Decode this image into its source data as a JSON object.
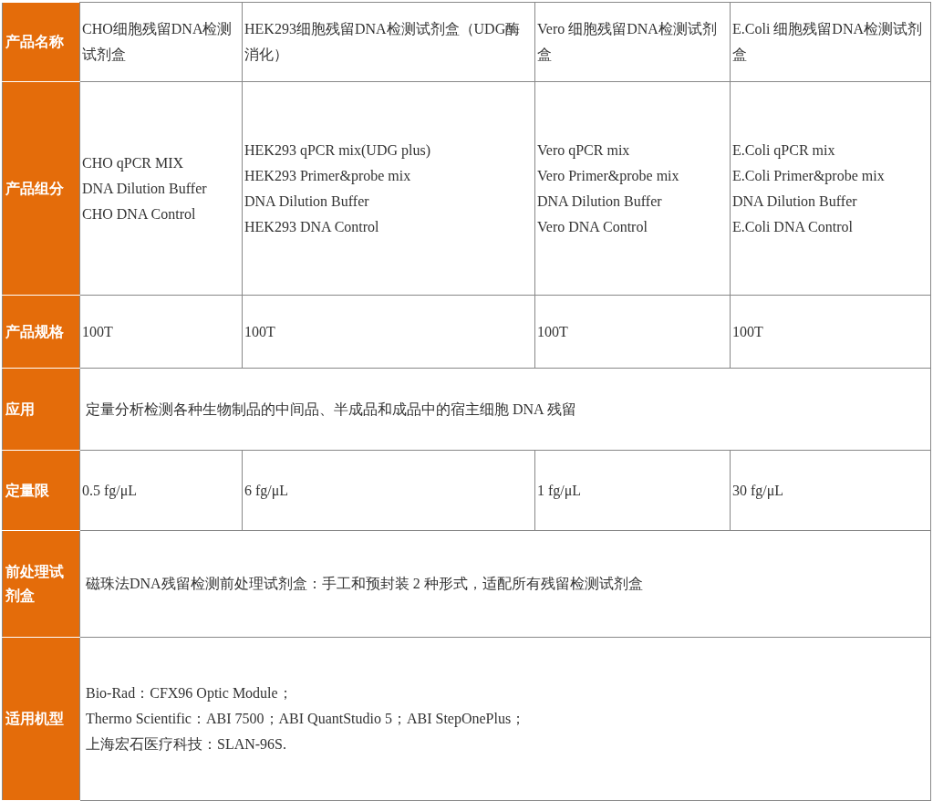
{
  "rows": [
    {
      "header": "产品名称",
      "kind": "cells",
      "cells": [
        {
          "lines": [
            "CHO细胞残留DNA检测试剂盒"
          ]
        },
        {
          "lines": [
            "HEK293细胞残留DNA检测试剂盒（UDG酶消化）"
          ]
        },
        {
          "lines": [
            "Vero 细胞残留DNA检测试剂盒"
          ]
        },
        {
          "lines": [
            "E.Coli 细胞残留DNA检测试剂盒"
          ]
        }
      ]
    },
    {
      "header": "产品组分",
      "kind": "cells",
      "cells": [
        {
          "lines": [
            "CHO qPCR MIX",
            "DNA Dilution Buffer",
            "CHO DNA Control"
          ]
        },
        {
          "lines": [
            "HEK293 qPCR mix(UDG plus)",
            "HEK293 Primer&probe mix",
            "DNA Dilution Buffer",
            "HEK293 DNA Control"
          ]
        },
        {
          "lines": [
            "Vero qPCR mix",
            "Vero Primer&probe mix",
            "DNA Dilution Buffer",
            "Vero  DNA Control"
          ]
        },
        {
          "lines": [
            "E.Coli qPCR mix",
            "E.Coli Primer&probe mix",
            "DNA Dilution Buffer",
            "E.Coli  DNA Control"
          ]
        }
      ]
    },
    {
      "header": "产品规格",
      "kind": "cells",
      "cells": [
        {
          "lines": [
            "100T"
          ]
        },
        {
          "lines": [
            "100T"
          ]
        },
        {
          "lines": [
            "100T"
          ]
        },
        {
          "lines": [
            "100T"
          ]
        }
      ]
    },
    {
      "header": "应用",
      "kind": "span",
      "lines": [
        "定量分析检测各种生物制品的中间品、半成品和成品中的宿主细胞 DNA 残留"
      ]
    },
    {
      "header": "定量限",
      "kind": "cells",
      "cells": [
        {
          "lines": [
            "0.5 fg/μL"
          ]
        },
        {
          "lines": [
            "6 fg/μL"
          ]
        },
        {
          "lines": [
            "1 fg/μL"
          ]
        },
        {
          "lines": [
            "30 fg/μL"
          ]
        }
      ]
    },
    {
      "header": "前处理试剂盒",
      "kind": "span",
      "lines": [
        "磁珠法DNA残留检测前处理试剂盒：手工和预封装 2 种形式，适配所有残留检测试剂盒"
      ]
    },
    {
      "header": "适用机型",
      "kind": "span",
      "lines": [
        "Bio-Rad：CFX96 Optic Module；",
        "Thermo Scientific：ABI 7500；ABI QuantStudio 5；ABI StepOnePlus；",
        "上海宏石医疗科技：SLAN-96S."
      ]
    }
  ]
}
